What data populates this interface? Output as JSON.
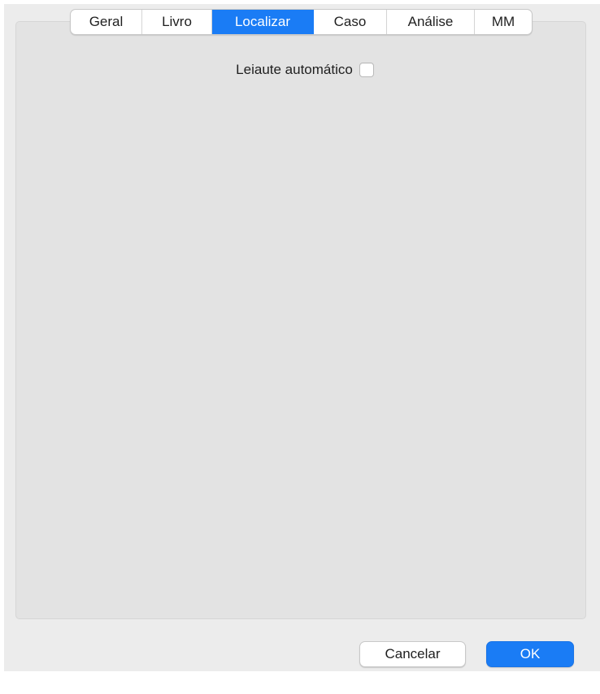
{
  "tabs": [
    {
      "label": "Geral",
      "active": false
    },
    {
      "label": "Livro",
      "active": false
    },
    {
      "label": "Localizar",
      "active": true
    },
    {
      "label": "Caso",
      "active": false
    },
    {
      "label": "Análise",
      "active": false
    },
    {
      "label": "MM",
      "active": false
    }
  ],
  "options": {
    "auto_layout_label": "Leiaute automático",
    "auto_layout_checked": false
  },
  "buttons": {
    "cancel_label": "Cancelar",
    "ok_label": "OK"
  },
  "colors": {
    "accent": "#1a7cf5",
    "window_bg": "#ececec",
    "panel_bg": "#e3e3e3"
  }
}
